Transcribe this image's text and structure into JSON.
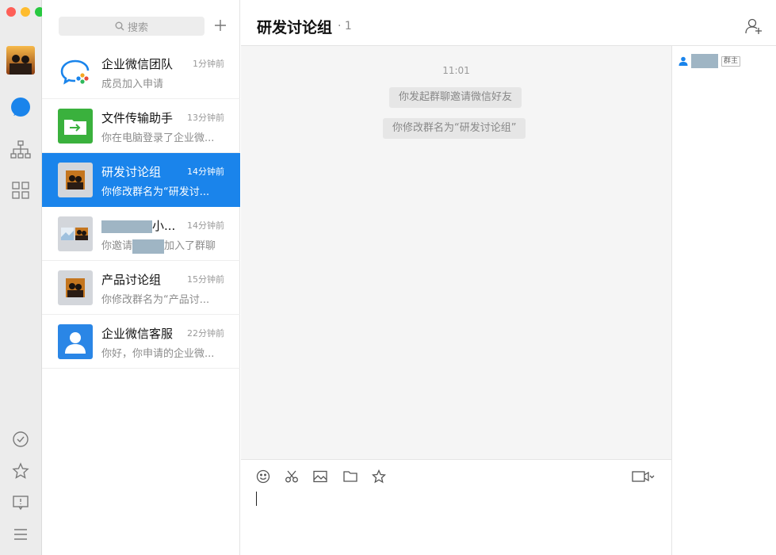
{
  "search": {
    "label": "搜索"
  },
  "conversations": [
    {
      "name": "企业微信团队",
      "time": "1分钟前",
      "preview": "成员加入申请"
    },
    {
      "name": "文件传输助手",
      "time": "13分钟前",
      "preview": "你在电脑登录了企业微..."
    },
    {
      "name": "研发讨论组",
      "time": "14分钟前",
      "preview": "你修改群名为“研发讨..."
    },
    {
      "name_suffix": "小...",
      "time": "14分钟前",
      "preview_prefix": "你邀请",
      "preview_suffix": "加入了群聊"
    },
    {
      "name": "产品讨论组",
      "time": "15分钟前",
      "preview": "你修改群名为“产品讨..."
    },
    {
      "name": "企业微信客服",
      "time": "22分钟前",
      "preview": "你好，你申请的企业微..."
    }
  ],
  "chat": {
    "title": "研发讨论组",
    "member_count": "· 1",
    "timestamp": "11:01",
    "system_messages": [
      "你发起群聊邀请微信好友",
      "你修改群名为“研发讨论组”"
    ]
  },
  "members": {
    "owner_badge": "群主"
  },
  "colors": {
    "accent": "#1a84eb",
    "rail": "#ececec",
    "chat_bg": "#f5f5f5"
  }
}
